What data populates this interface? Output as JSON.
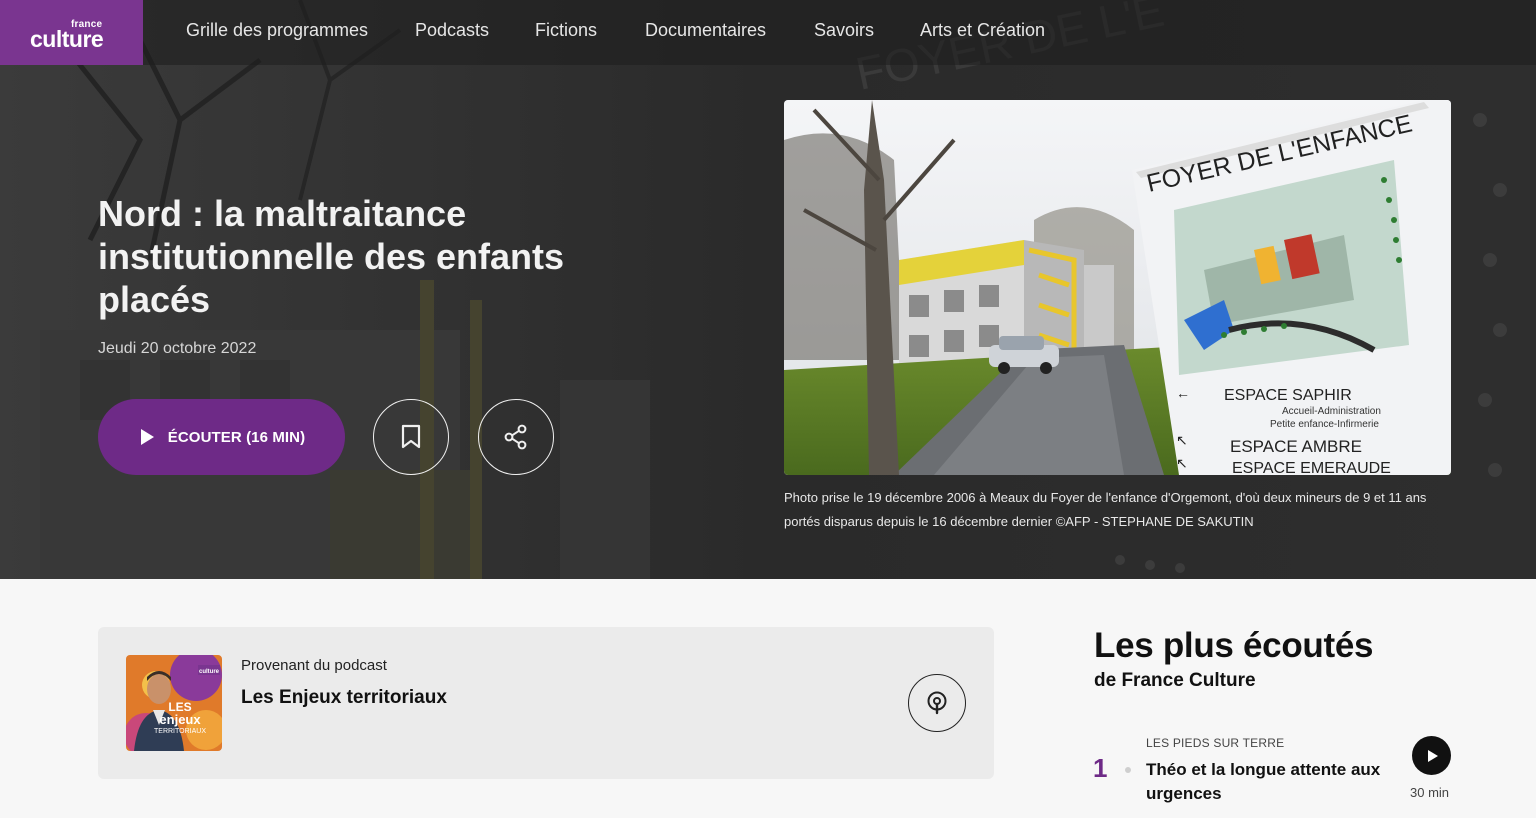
{
  "brand": {
    "small": "france",
    "big": "culture",
    "color": "#7a3590"
  },
  "nav": {
    "items": [
      {
        "label": "Grille des programmes"
      },
      {
        "label": "Podcasts"
      },
      {
        "label": "Fictions"
      },
      {
        "label": "Documentaires"
      },
      {
        "label": "Savoirs"
      },
      {
        "label": "Arts et Création"
      }
    ]
  },
  "article": {
    "title": "Nord : la maltraitance institutionnelle des enfants placés",
    "date": "Jeudi 20 octobre 2022",
    "listen_label": "ÉCOUTER (16 MIN)",
    "bookmark_icon": "bookmark-icon",
    "share_icon": "share-icon",
    "photo_sign": {
      "heading": "FOYER DE L'ENFANCE",
      "saphir": "ESPACE SAPHIR",
      "saphir_detail1": "Accueil-Administration",
      "saphir_detail2": "Petite enfance-Infirmerie",
      "ambre": "ESPACE AMBRE",
      "emeraude": "ESPACE EMERAUDE"
    },
    "caption": "Photo prise le 19 décembre 2006 à Meaux du Foyer de l'enfance d'Orgemont, d'où deux mineurs de 9 et 11 ans portés disparus depuis le 16 décembre dernier ©AFP - STEPHANE DE SAKUTIN"
  },
  "podcast": {
    "from_label": "Provenant du podcast",
    "name": "Les Enjeux territoriaux",
    "thumb_brand": "culture",
    "thumb_title1": "LES",
    "thumb_title2": "enjeux",
    "thumb_title3": "TERRITORIAUX"
  },
  "most_listened": {
    "title": "Les plus écoutés",
    "subtitle": "de France Culture",
    "items": [
      {
        "rank": "1",
        "show": "LES PIEDS SUR TERRE",
        "title": "Théo et la longue attente aux urgences",
        "duration": "30 min"
      }
    ]
  },
  "colors": {
    "accent": "#6e2a87",
    "hero_bg": "#2b2b2b",
    "card_bg": "#ebebeb"
  }
}
